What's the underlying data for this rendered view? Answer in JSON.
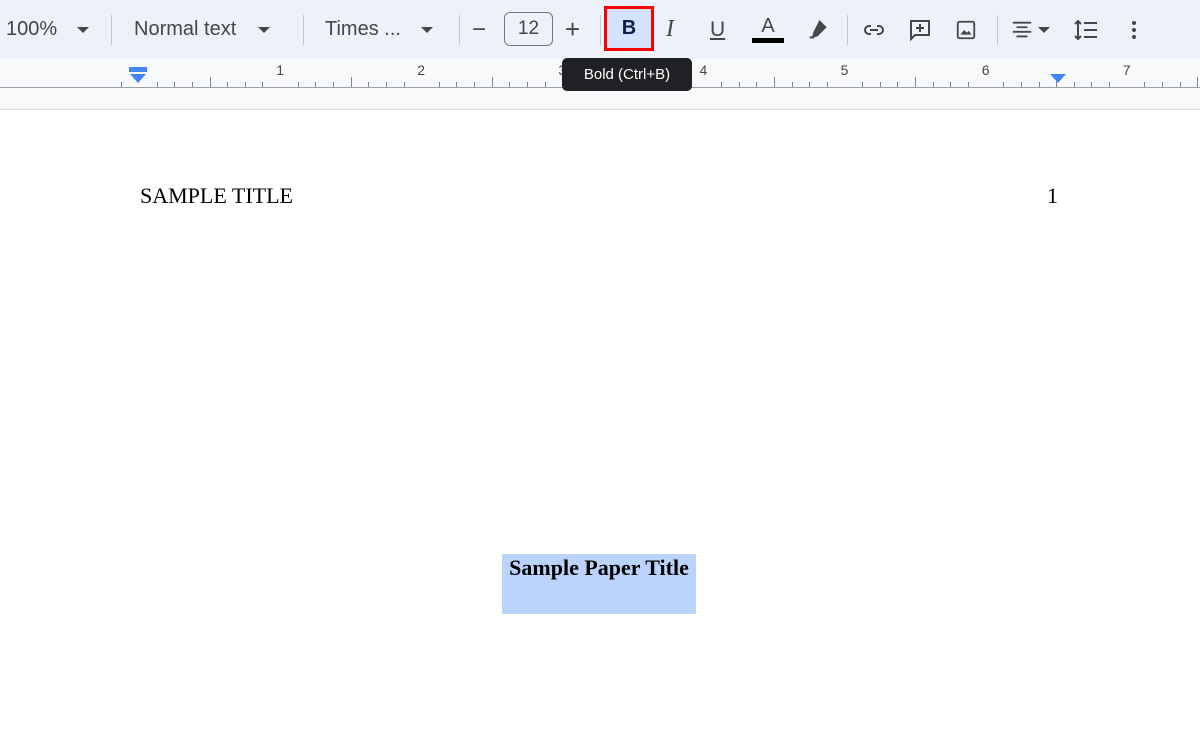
{
  "toolbar": {
    "zoom": "100%",
    "style": "Normal text",
    "font": "Times ...",
    "font_size": "12",
    "decrease_label": "−",
    "increase_label": "+",
    "bold_label": "B",
    "italic_label": "I",
    "underline_label": "U",
    "text_color_label": "A",
    "text_color": "#000000",
    "highlight_box_color": "#ff0000",
    "icons": [
      "highlighter-icon",
      "link-icon",
      "add-comment-icon",
      "insert-image-icon",
      "align-center-icon",
      "line-spacing-icon",
      "more-icon"
    ]
  },
  "tooltip": "Bold (Ctrl+B)",
  "ruler": {
    "labels": [
      "1",
      "2",
      "3",
      "4",
      "5",
      "6",
      "7"
    ]
  },
  "document": {
    "header_title": "SAMPLE TITLE",
    "page_number": "1",
    "paper_title": "Sample Paper Title",
    "selection_color": "#b9d3fb"
  }
}
